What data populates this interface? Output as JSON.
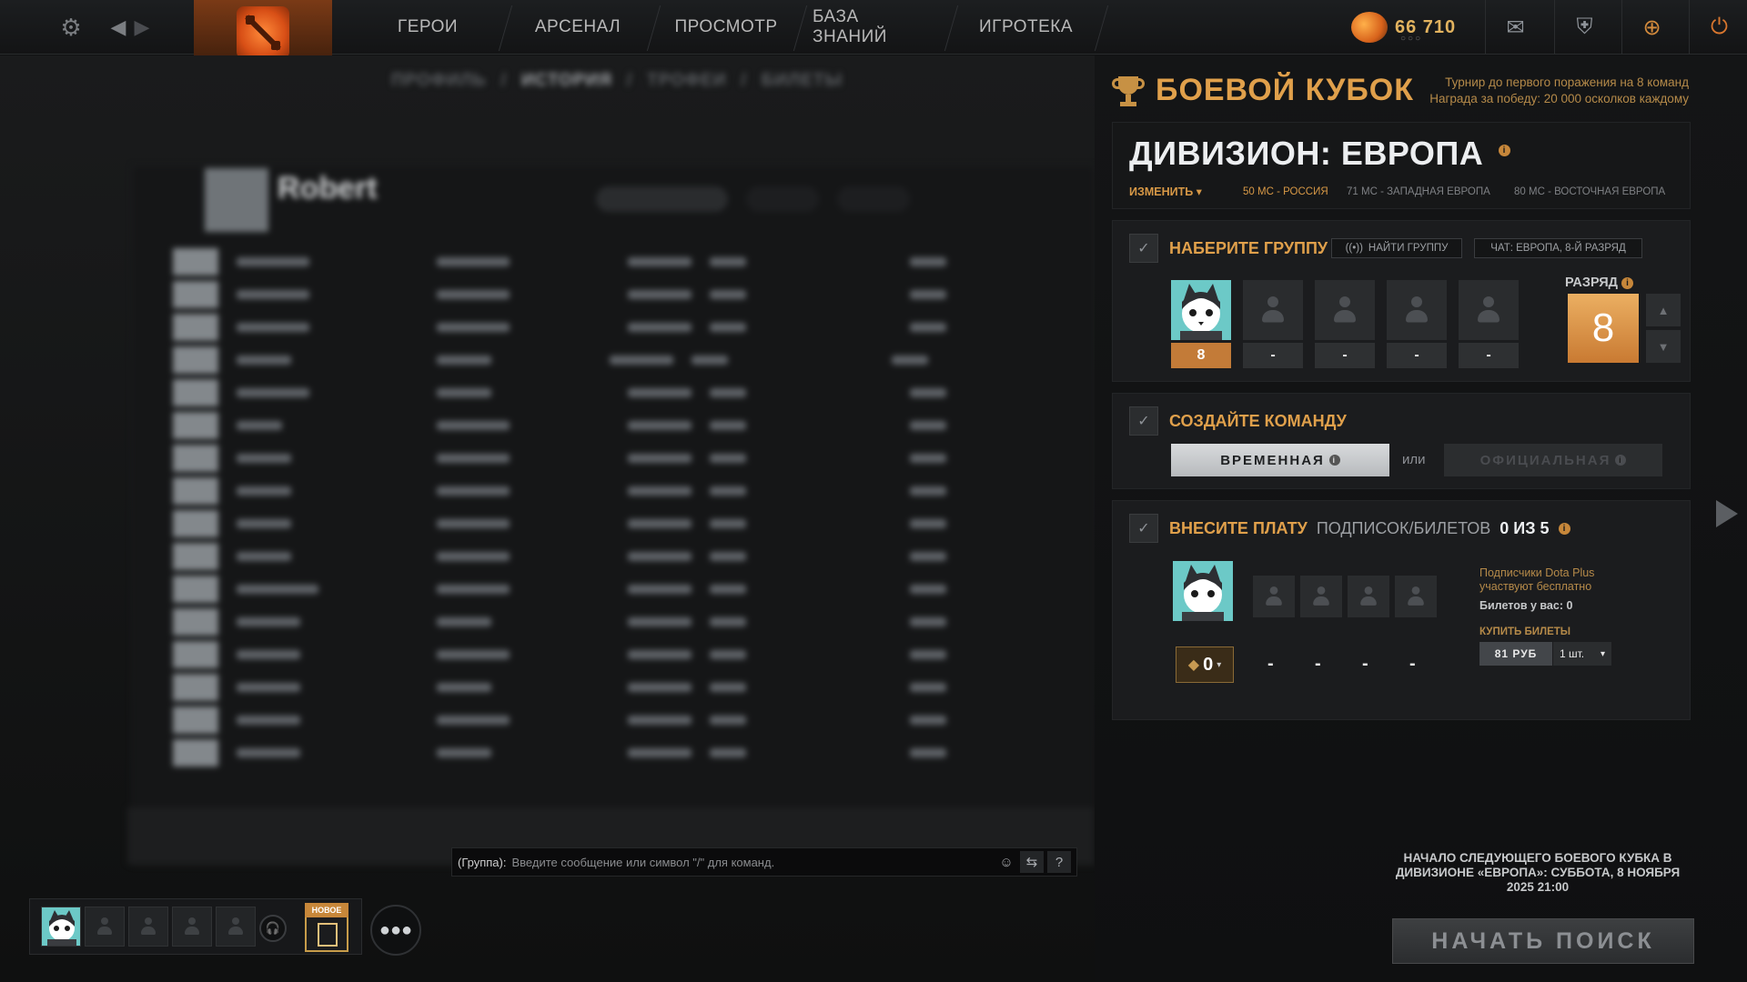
{
  "topbar": {
    "nav": [
      "ГЕРОИ",
      "АРСЕНАЛ",
      "ПРОСМОТР",
      "БАЗА ЗНАНИЙ",
      "ИГРОТЕКА"
    ],
    "currency_value": "66 710",
    "currency_dots": "○○○",
    "icons": [
      "settings-gear-icon",
      "back-arrow-icon",
      "forward-arrow-icon",
      "dota-logo",
      "mail-icon",
      "armory-icon",
      "plus-icon",
      "power-icon"
    ]
  },
  "background": {
    "breadcrumb": [
      "ПРОФИЛЬ",
      "/",
      "ИСТОРИЯ",
      "/",
      "ТРОФЕИ",
      "/",
      "БИЛЕТЫ"
    ],
    "profile_name": "Robert"
  },
  "chat": {
    "channel": "(Группа):",
    "placeholder": "Введите сообщение или символ \"/\" для команд.",
    "help": "?"
  },
  "party_bar": {
    "new_label": "НОВОЕ"
  },
  "battle_cup": {
    "title": "БОЕВОЙ КУБОК",
    "subtitle_line1": "Турнир до первого поражения на 8 команд",
    "subtitle_line2": "Награда за победу: 20 000 осколков каждому",
    "division_title": "ДИВИЗИОН: ЕВРОПА",
    "change_label": "ИЗМЕНИТЬ ▾",
    "pings": [
      {
        "text": "50 МС - РОССИЯ",
        "color": "#d79846"
      },
      {
        "text": "71 МС - ЗАПАДНАЯ ЕВРОПА",
        "color": "#7e8084"
      },
      {
        "text": "80 МС - ВОСТОЧНАЯ ЕВРОПА",
        "color": "#7e8084"
      }
    ],
    "step1": {
      "title": "НАБЕРИТЕ ГРУППУ",
      "find_group": "НАЙТИ ГРУППУ",
      "chat_label": "ЧАТ: ЕВРОПА, 8-Й РАЗРЯД",
      "rank_label": "РАЗРЯД",
      "rank_value": "8",
      "slots": [
        "8",
        "-",
        "-",
        "-",
        "-"
      ]
    },
    "step2": {
      "title": "СОЗДАЙТЕ КОМАНДУ",
      "temp_label": "ВРЕМЕННАЯ",
      "or_label": "или",
      "official_label": "ОФИЦИАЛЬНАЯ"
    },
    "step3": {
      "title": "ВНЕСИТЕ ПЛАТУ",
      "subtitle": "ПОДПИСОК/БИЛЕТОВ",
      "count": "0 ИЗ 5",
      "ticket_count": "0",
      "slots": [
        "-",
        "-",
        "-",
        "-"
      ],
      "dota_plus_line1": "Подписчики Dota Plus",
      "dota_plus_line2": "участвуют бесплатно",
      "tickets_owned": "Билетов у вас: 0",
      "buy_label": "КУПИТЬ БИЛЕТЫ",
      "price": "81 РУБ",
      "quantity": "1 шт."
    },
    "next_cup": "НАЧАЛО СЛЕДУЮЩЕГО БОЕВОГО КУБКА В ДИВИЗИОНЕ «ЕВРОПА»: СУББОТА, 8 НОЯБРЯ 2025 21:00",
    "search_button": "НАЧАТЬ ПОИСК"
  },
  "colors": {
    "accent_gold": "#e0a04b",
    "rank_orange": "#c97a32",
    "panel_bg": "#1b1c1e"
  }
}
